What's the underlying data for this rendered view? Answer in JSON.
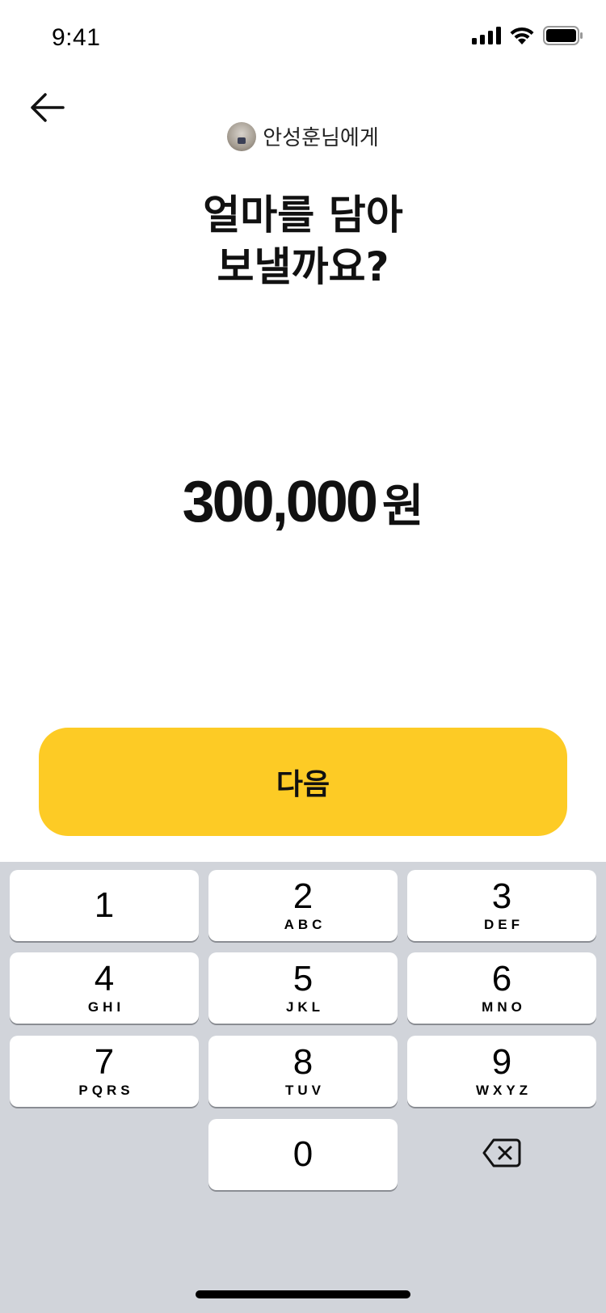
{
  "status_bar": {
    "time": "9:41",
    "icons": [
      "cellular-signal-icon",
      "wifi-icon",
      "battery-icon"
    ]
  },
  "header": {
    "back_icon": "arrow-left-icon",
    "recipient_label": "안성훈님에게"
  },
  "title": {
    "line1": "얼마를 담아",
    "line2": "보낼까요?"
  },
  "amount": {
    "value": "300,000",
    "unit": "원"
  },
  "next_button": {
    "label": "다음"
  },
  "keypad": {
    "keys": [
      {
        "digit": "1",
        "letters": ""
      },
      {
        "digit": "2",
        "letters": "ABC"
      },
      {
        "digit": "3",
        "letters": "DEF"
      },
      {
        "digit": "4",
        "letters": "GHI"
      },
      {
        "digit": "5",
        "letters": "JKL"
      },
      {
        "digit": "6",
        "letters": "MNO"
      },
      {
        "digit": "7",
        "letters": "PQRS"
      },
      {
        "digit": "8",
        "letters": "TUV"
      },
      {
        "digit": "9",
        "letters": "WXYZ"
      },
      {
        "digit": "0",
        "letters": ""
      }
    ],
    "delete_icon": "backspace-icon"
  },
  "colors": {
    "accent": "#FDCB25",
    "keypad_background": "#D1D4DA",
    "key_background": "#FFFFFF"
  }
}
